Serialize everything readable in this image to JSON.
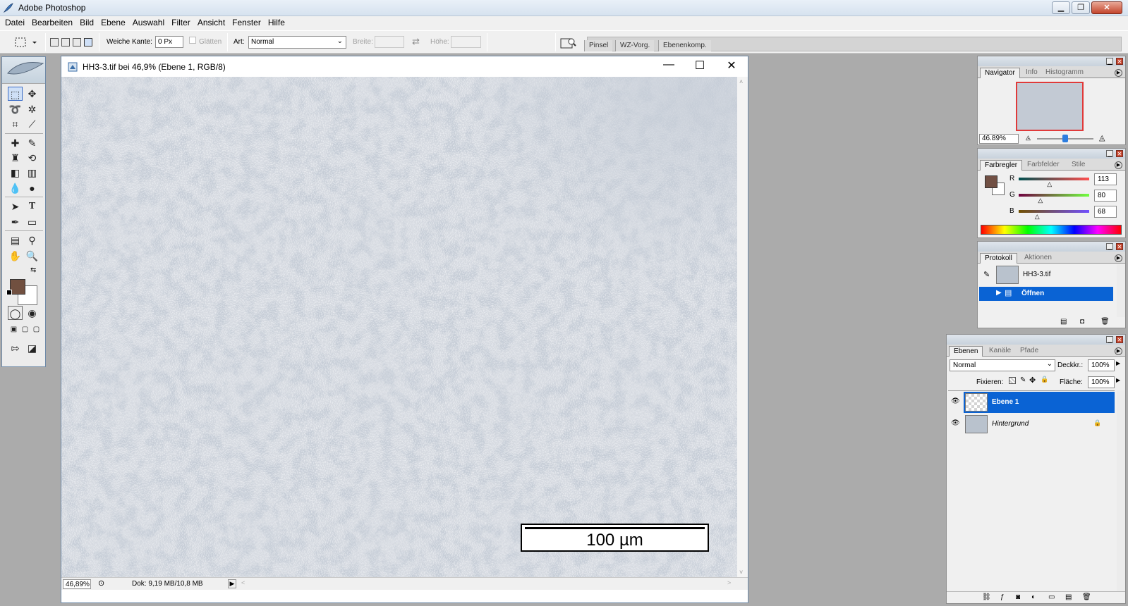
{
  "app": {
    "title": "Adobe Photoshop",
    "min": "▁",
    "restore": "❐",
    "close": "✕"
  },
  "menu": [
    "Datei",
    "Bearbeiten",
    "Bild",
    "Ebene",
    "Auswahl",
    "Filter",
    "Ansicht",
    "Fenster",
    "Hilfe"
  ],
  "options": {
    "feather_label": "Weiche Kante:",
    "feather_value": "0 Px",
    "smooth_label": "Glätten",
    "style_label": "Art:",
    "style_value": "Normal",
    "width_label": "Breite:",
    "height_label": "Höhe:",
    "well_tabs": [
      "Pinsel",
      "WZ-Vorg.",
      "Ebenenkomp."
    ]
  },
  "document": {
    "title": "HH3-3.tif bei 46,9% (Ebene 1, RGB/8)",
    "zoom": "46,89%",
    "doc_info": "Dok: 9,19 MB/10,8 MB",
    "scalebar_label": "100 µm",
    "ctl_min": "—",
    "ctl_max": "☐",
    "ctl_close": "✕"
  },
  "navigator": {
    "tabs": [
      "Navigator",
      "Info",
      "Histogramm"
    ],
    "zoom_value": "46.89%",
    "zoom_fraction": 0.5
  },
  "color": {
    "tabs": [
      "Farbregler",
      "Farbfelder",
      "Stile"
    ],
    "channels": [
      {
        "label": "R",
        "value": "113",
        "level": 0.443,
        "track": "linear-gradient(to right, #005050, #ff5050)"
      },
      {
        "label": "G",
        "value": "80",
        "level": 0.314,
        "track": "linear-gradient(to right, #710040, #71ff40)"
      },
      {
        "label": "B",
        "value": "68",
        "level": 0.267,
        "track": "linear-gradient(to right, #715000, #7150ff)"
      }
    ],
    "foreground": "#715044",
    "background": "#ffffff"
  },
  "history": {
    "tabs": [
      "Protokoll",
      "Aktionen"
    ],
    "snapshot": "HH3-3.tif",
    "steps": [
      "Öffnen"
    ]
  },
  "layers": {
    "tabs": [
      "Ebenen",
      "Kanäle",
      "Pfade"
    ],
    "blend_mode": "Normal",
    "opacity_label": "Deckkr.:",
    "opacity_value": "100%",
    "lock_label": "Fixieren:",
    "fill_label": "Fläche:",
    "fill_value": "100%",
    "items": [
      {
        "name": "Ebene 1",
        "selected": true
      },
      {
        "name": "Hintergrund",
        "selected": false
      }
    ]
  },
  "icons": {
    "eye": "👁",
    "lock": "🔒",
    "arrow_right": "▶",
    "chevron_down": "⌄"
  }
}
